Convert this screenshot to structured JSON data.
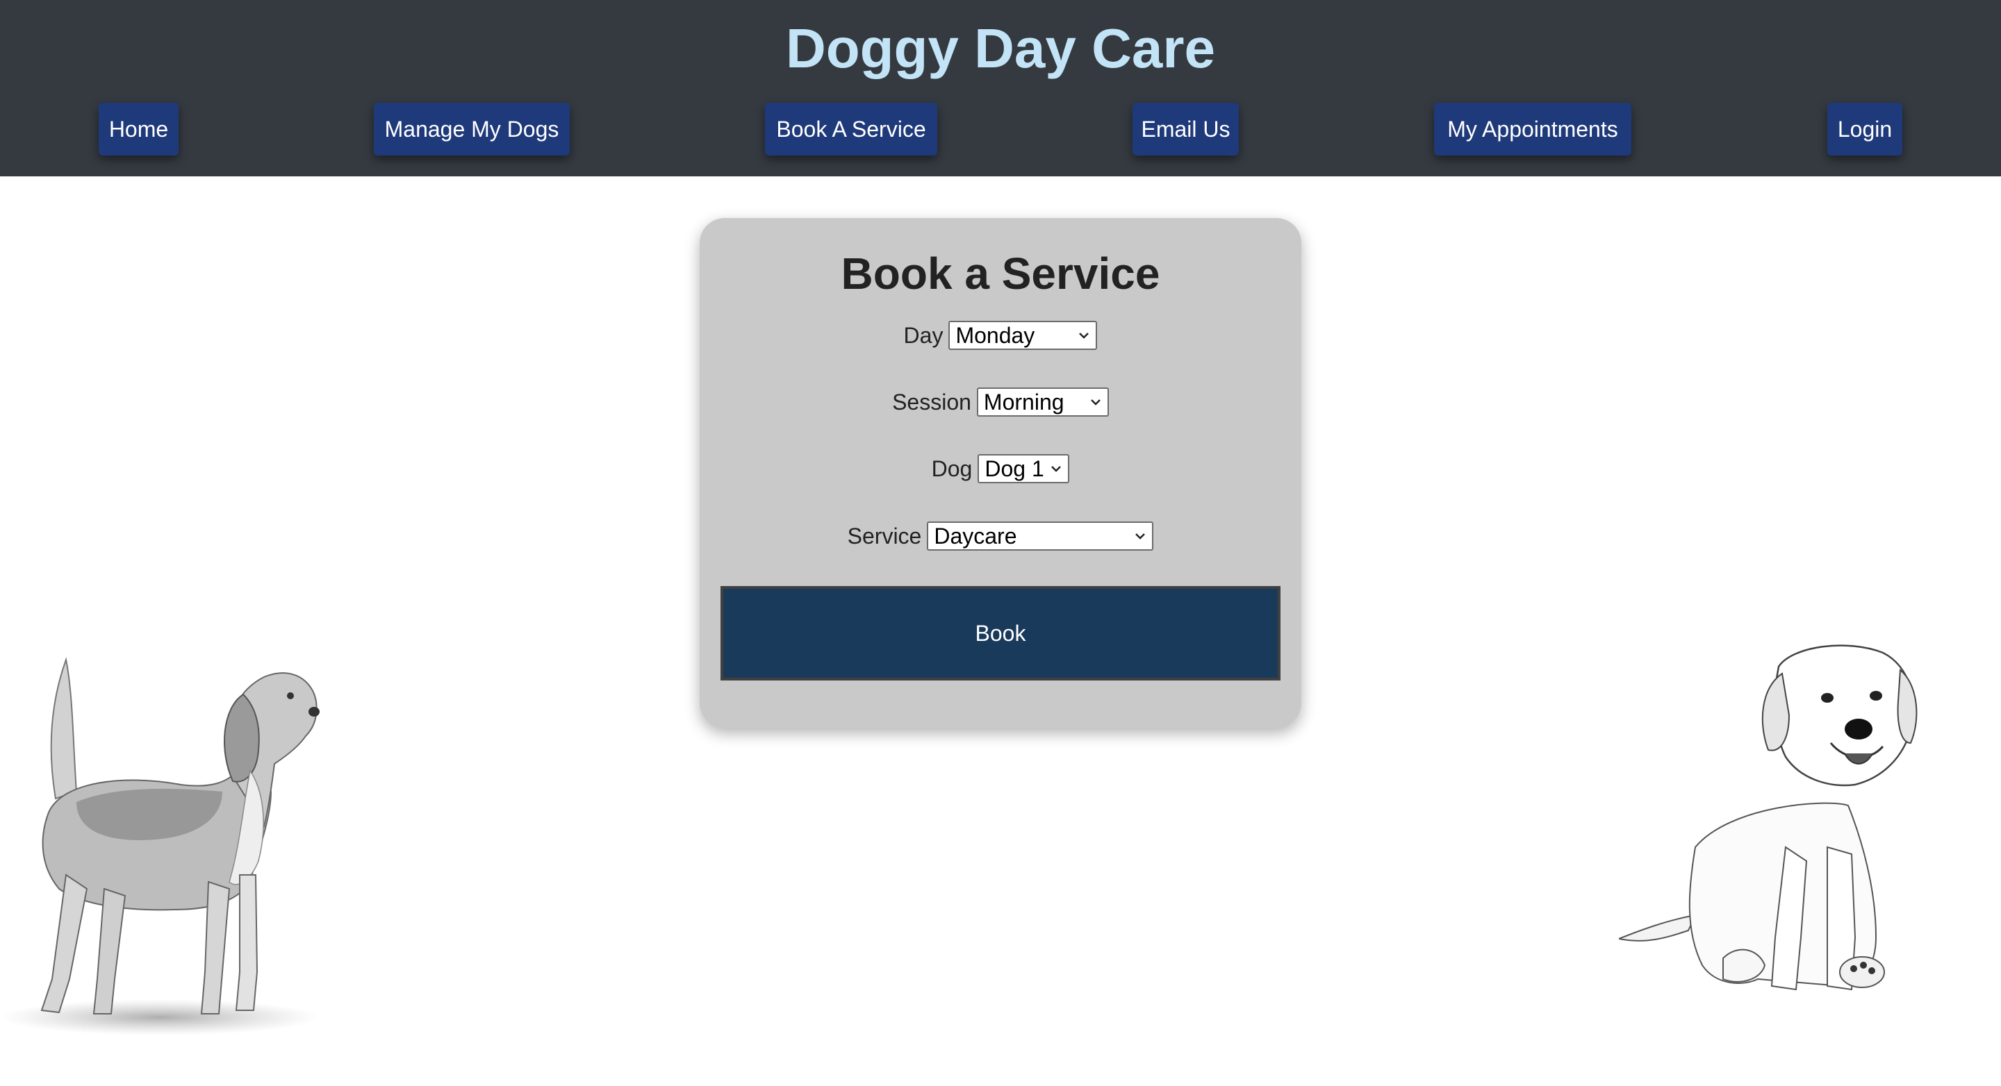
{
  "header": {
    "title": "Doggy Day Care",
    "nav": [
      {
        "label": "Home"
      },
      {
        "label": "Manage My Dogs"
      },
      {
        "label": "Book A Service"
      },
      {
        "label": "Email Us"
      },
      {
        "label": "My Appointments"
      },
      {
        "label": "Login"
      }
    ]
  },
  "form": {
    "title": "Book a Service",
    "day": {
      "label": "Day",
      "value": "Monday"
    },
    "session": {
      "label": "Session",
      "value": "Morning"
    },
    "dog": {
      "label": "Dog",
      "value": "Dog 1"
    },
    "service": {
      "label": "Service",
      "value": "Daycare"
    },
    "submit_label": "Book"
  },
  "colors": {
    "header_bg": "#343a40",
    "title": "#c3e3f7",
    "nav_button": "#1f3a7a",
    "card_bg": "#c9c9c9",
    "book_button": "#1a3a5c"
  },
  "images": {
    "left": "beagle-sketch",
    "right": "golden-retriever-puppy-sketch"
  }
}
